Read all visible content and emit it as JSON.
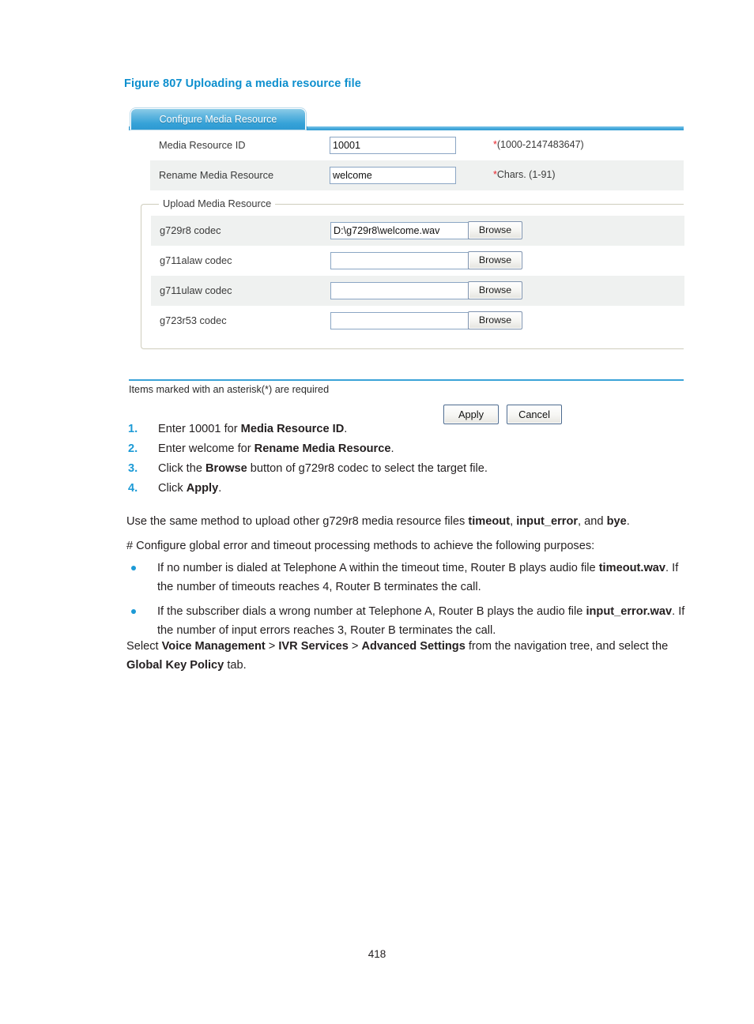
{
  "figure": {
    "caption": "Figure 807 Uploading a media resource file",
    "caption_color": "#0d8fce",
    "tab_label": "Configure Media Resource",
    "accent_color": "#3ba3d8"
  },
  "form": {
    "rows": [
      {
        "label": "Media Resource ID",
        "value": "10001",
        "placeholder": "",
        "hint_star": "*",
        "hint_text": "(1000-2147483647)"
      },
      {
        "label": "Rename Media Resource",
        "value": "welcome",
        "placeholder": "",
        "hint_star": "*",
        "hint_text": "Chars. (1-91)"
      }
    ],
    "group": {
      "title": "Upload Media Resource",
      "browse_label": "Browse",
      "codecs": [
        {
          "label": "g729r8 codec",
          "value": "D:\\g729r8\\welcome.wav",
          "placeholder": ""
        },
        {
          "label": "g711alaw codec",
          "value": "",
          "placeholder": ""
        },
        {
          "label": "g711ulaw codec",
          "value": "",
          "placeholder": ""
        },
        {
          "label": "g723r53 codec",
          "value": "",
          "placeholder": ""
        }
      ]
    },
    "required_note": "Items marked with an asterisk(*) are required",
    "apply_label": "Apply",
    "cancel_label": "Cancel"
  },
  "steps": [
    {
      "num": "1.",
      "html": "Enter 10001 for <b>Media Resource ID</b>."
    },
    {
      "num": "2.",
      "html": "Enter welcome for <b>Rename Media Resource</b>."
    },
    {
      "num": "3.",
      "html": "Click the <b>Browse</b> button of g729r8 codec to select the target file."
    },
    {
      "num": "4.",
      "html": "Click <b>Apply</b>."
    }
  ],
  "paragraphs": {
    "same_method": "Use the same method to upload other g729r8 media resource files <b>timeout</b>, <b>input_error</b>, and <b>bye</b>.",
    "configure": "# Configure global error and timeout processing methods to achieve the following purposes:",
    "select": "Select <b>Voice Management</b> &gt; <b>IVR Services</b> &gt; <b>Advanced Settings</b> from the navigation tree, and select the <b>Global Key Policy</b> tab."
  },
  "bullets": [
    "If no number is dialed at Telephone A within the timeout time, Router B plays audio file <b>timeout.wav</b>. If the number of timeouts reaches 4, Router B terminates the call.",
    "If the subscriber dials a wrong number at Telephone A, Router B plays the audio file <b>input_error.wav</b>. If the number of input errors reaches 3, Router B terminates the call."
  ],
  "page_number": "418"
}
